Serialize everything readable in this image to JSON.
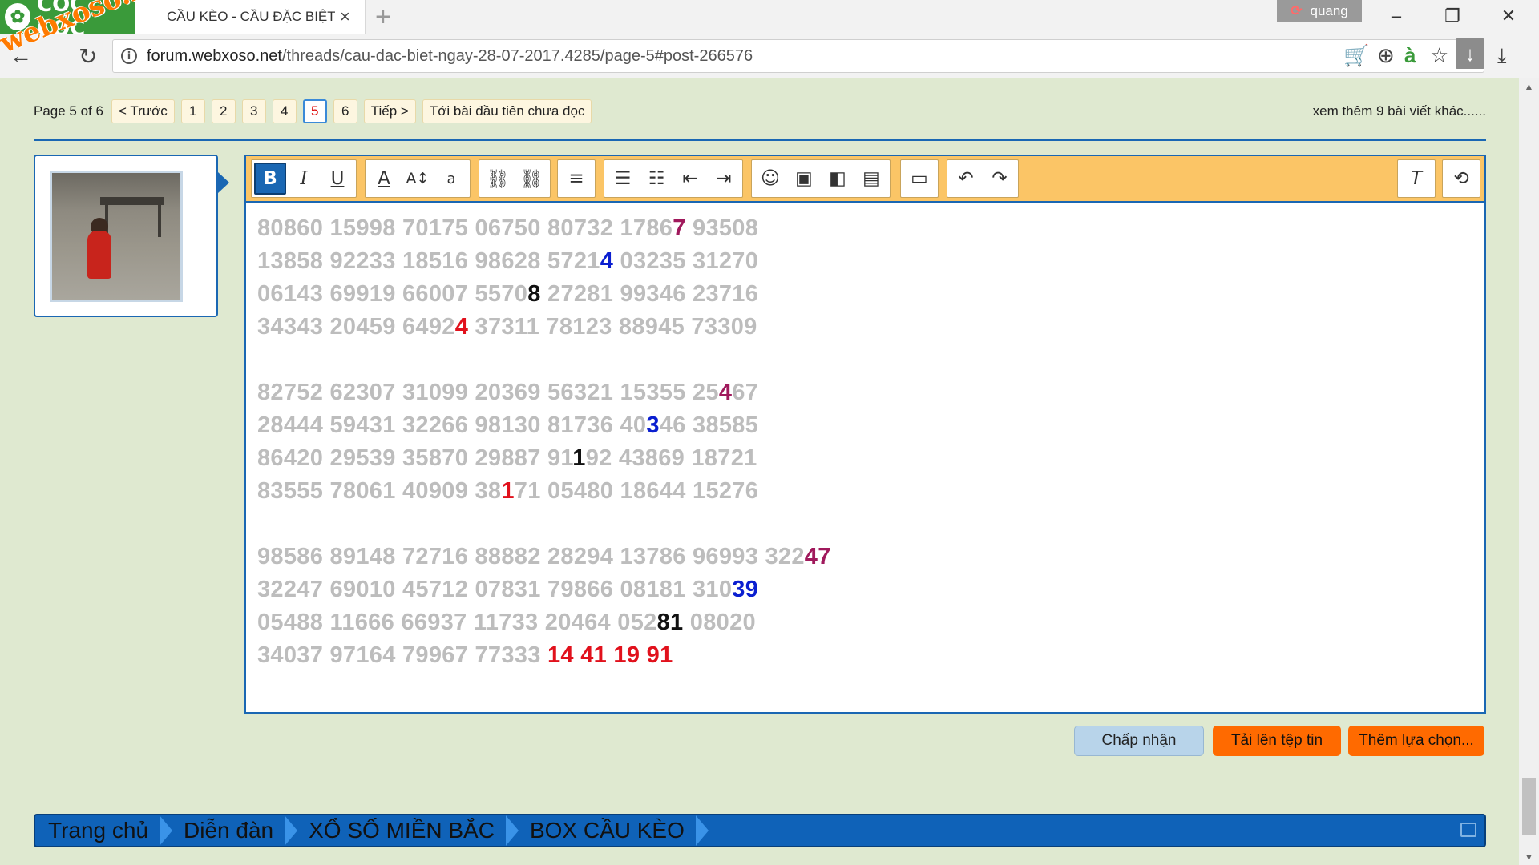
{
  "browser": {
    "brand": "CỐC CỐC",
    "watermark": "webxoso.net",
    "tab_title": "CẦU KÈO - CẦU ĐẶC BIỆT",
    "tab_close": "×",
    "new_tab": "+",
    "user_name": "quang",
    "url_host": "forum.webxoso.net",
    "url_path": "/threads/cau-dac-biet-ngay-28-07-2017.4285/page-5#post-266576"
  },
  "pagenav": {
    "label": "Page 5 of 6",
    "prev": "< Trước",
    "pages": [
      "1",
      "2",
      "3",
      "4",
      "5",
      "6"
    ],
    "current": "5",
    "next": "Tiếp >",
    "first_unread": "Tới bài đầu tiên chưa đọc",
    "more": "xem thêm 9 bài viết khác......"
  },
  "editor": {
    "blocks": [
      [
        [
          {
            "t": "80860 15998 70175 06750 80732 1786"
          },
          {
            "t": "7",
            "c": "purple"
          },
          {
            "t": " 93508"
          }
        ],
        [
          {
            "t": "13858 92233 18516 98628 5721"
          },
          {
            "t": "4",
            "c": "blue"
          },
          {
            "t": " 03235 31270"
          }
        ],
        [
          {
            "t": "06143 69919 66007 5570"
          },
          {
            "t": "8",
            "c": "black"
          },
          {
            "t": " 27281 99346 23716"
          }
        ],
        [
          {
            "t": "34343 20459 6492"
          },
          {
            "t": "4",
            "c": "red"
          },
          {
            "t": " 37311 78123 88945 73309"
          }
        ]
      ],
      [
        [
          {
            "t": "82752 62307 31099 20369 56321 15355 25"
          },
          {
            "t": "4",
            "c": "purple"
          },
          {
            "t": "67"
          }
        ],
        [
          {
            "t": "28444 59431 32266 98130 81736 40"
          },
          {
            "t": "3",
            "c": "blue"
          },
          {
            "t": "46 38585"
          }
        ],
        [
          {
            "t": "86420 29539 35870 29887 91"
          },
          {
            "t": "1",
            "c": "black"
          },
          {
            "t": "92 43869 18721"
          }
        ],
        [
          {
            "t": "83555 78061 40909 38"
          },
          {
            "t": "1",
            "c": "red"
          },
          {
            "t": "71 05480 18644 15276"
          }
        ]
      ],
      [
        [
          {
            "t": "98586 89148 72716 88882 28294 13786 96993 322"
          },
          {
            "t": "47",
            "c": "purple"
          }
        ],
        [
          {
            "t": "32247 69010 45712 07831 79866 08181 310"
          },
          {
            "t": "39",
            "c": "blue"
          }
        ],
        [
          {
            "t": "05488 11666 66937 11733 20464 052"
          },
          {
            "t": "81",
            "c": "black"
          },
          {
            "t": " 08020"
          }
        ],
        [
          {
            "t": "34037 97164 79967 77333 "
          },
          {
            "t": "14 41 19 91",
            "c": "red"
          }
        ]
      ]
    ],
    "colors": {
      "purple": "#a0195c",
      "blue": "#0b1fd0",
      "black": "#111111",
      "red": "#e1111c",
      "gray": "#bdbdbd"
    }
  },
  "actions": {
    "accept": "Chấp nhận",
    "upload": "Tải lên tệp tin",
    "more_options": "Thêm lựa chọn..."
  },
  "breadcrumb": [
    "Trang chủ",
    "Diễn đàn",
    "XỔ SỐ MIỀN BẮC",
    "BOX CẦU KÈO"
  ]
}
